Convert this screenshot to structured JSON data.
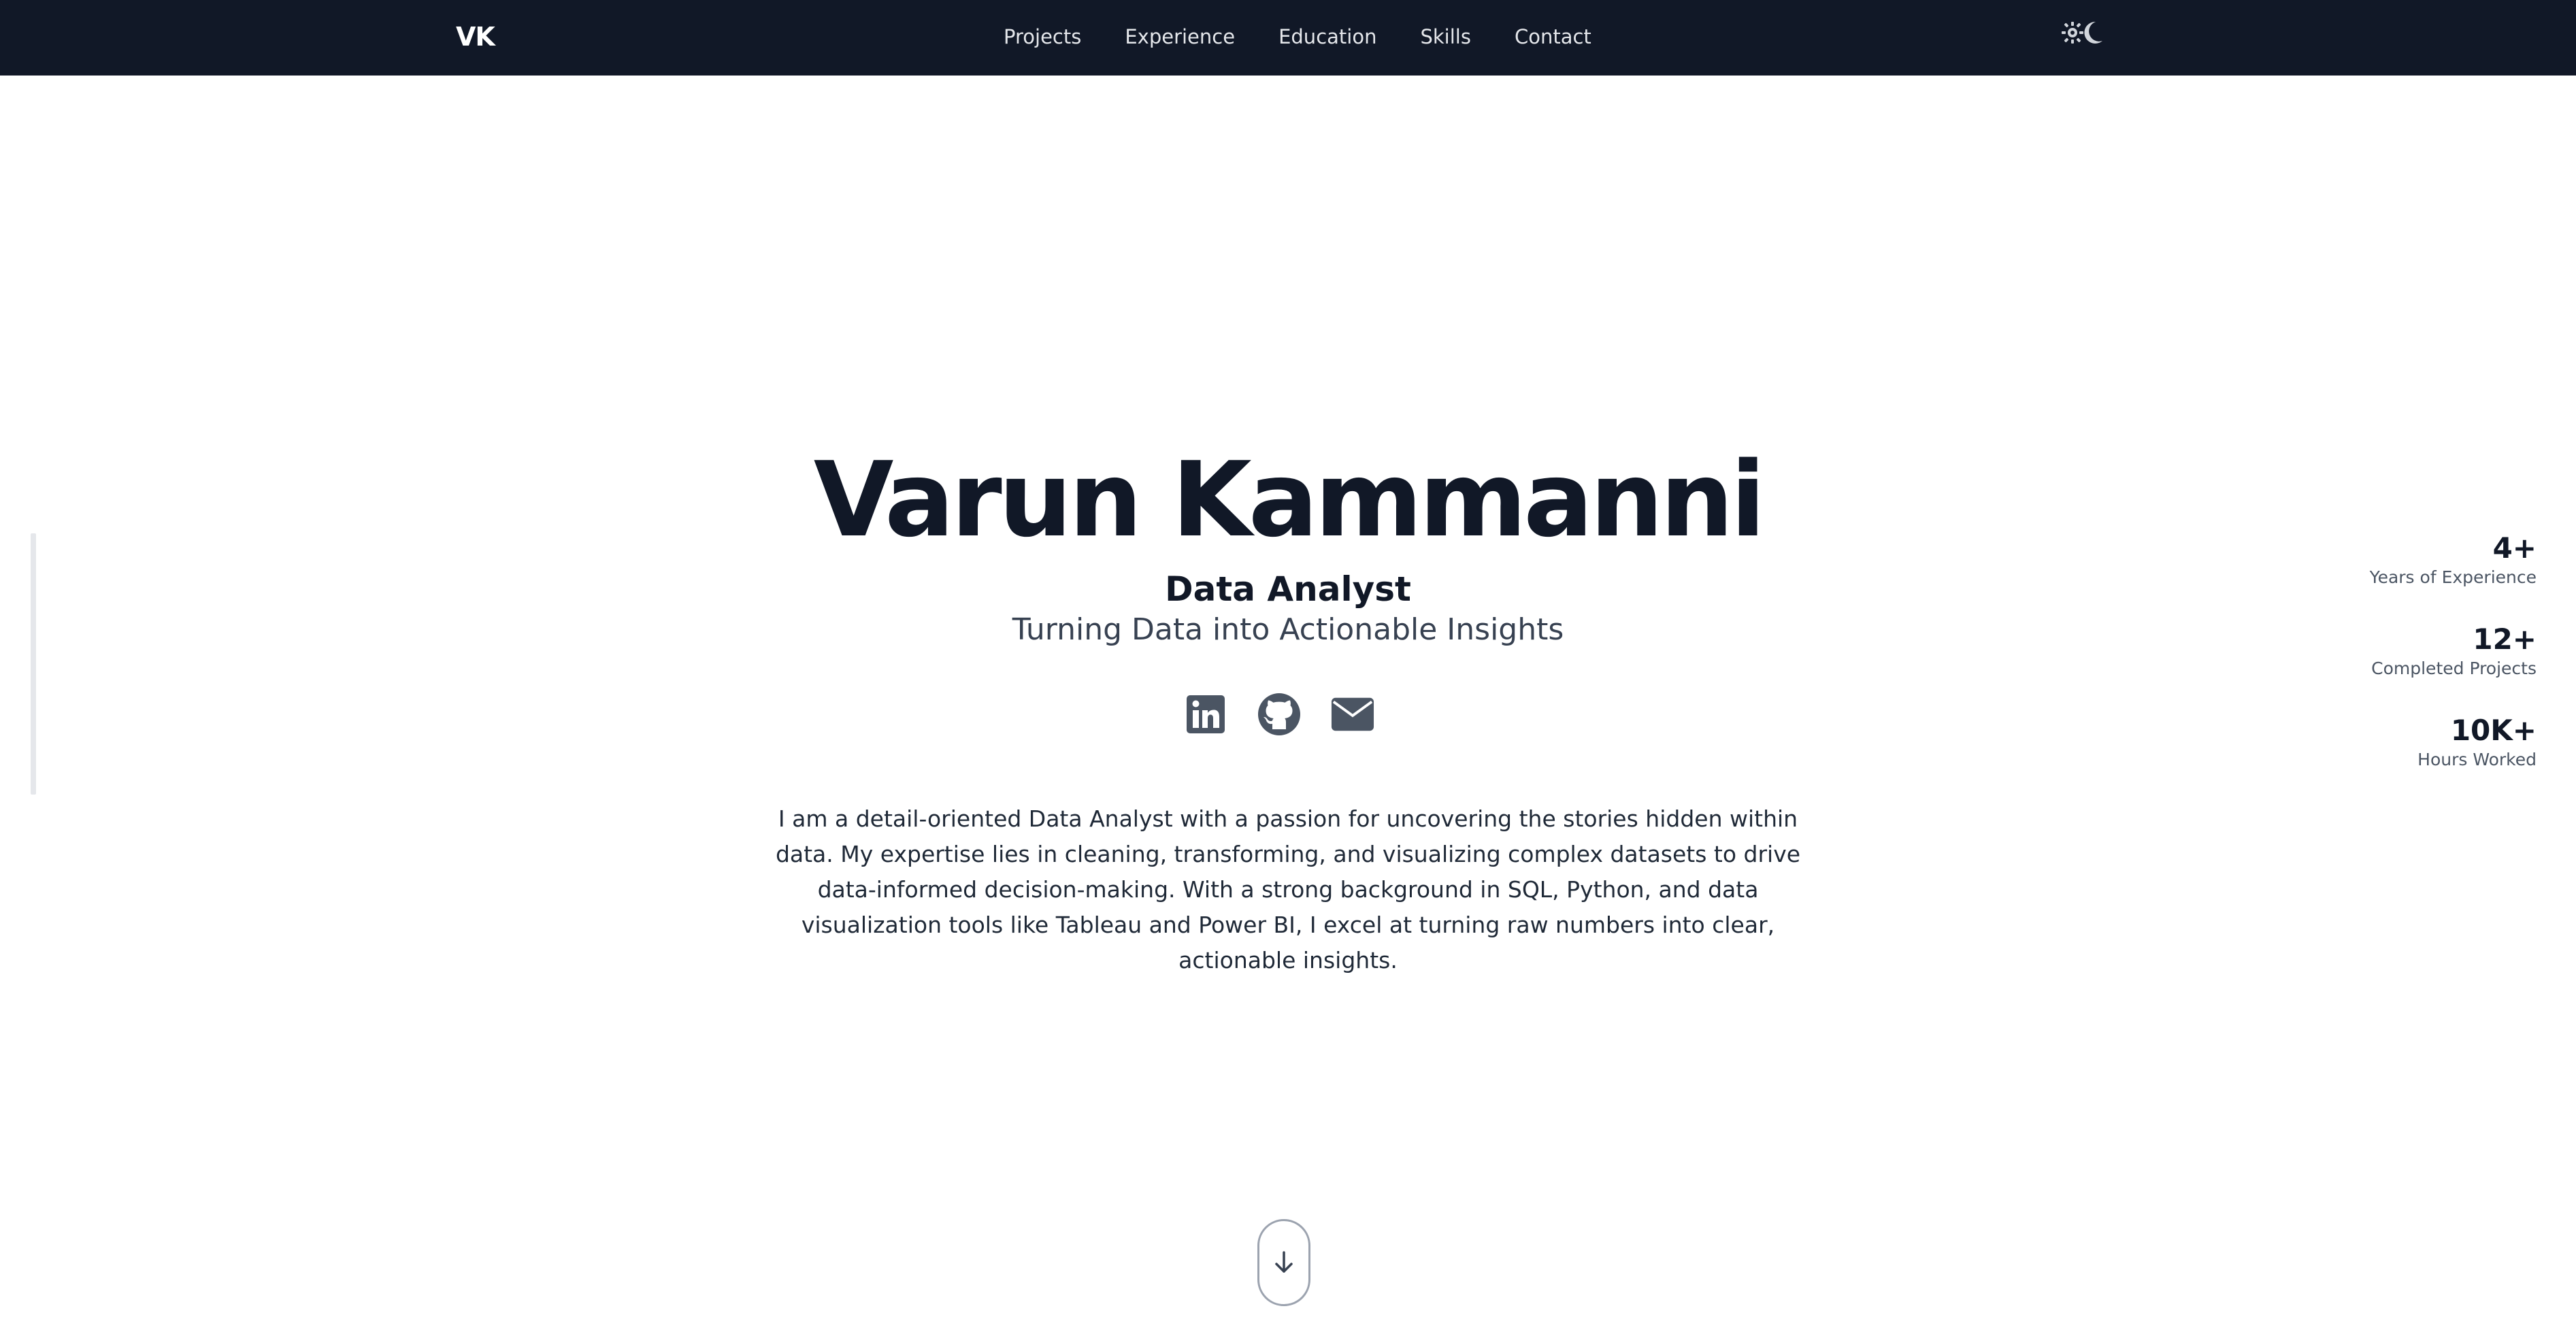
{
  "nav": {
    "logo": "VK",
    "links": [
      "Projects",
      "Experience",
      "Education",
      "Skills",
      "Contact"
    ],
    "theme_toggle_icon": "sun-moon-icon"
  },
  "hero": {
    "name": "Varun Kammanni",
    "role": "Data Analyst",
    "tagline": "Turning Data into Actionable Insights",
    "socials": [
      "linkedin-icon",
      "github-icon",
      "email-icon"
    ],
    "bio": "I am a detail-oriented Data Analyst with a passion for uncovering the stories hidden within data. My expertise lies in cleaning, transforming, and visualizing complex datasets to drive data-informed decision-making. With a strong background in SQL, Python, and data visualization tools like Tableau and Power BI, I excel at turning raw numbers into clear, actionable insights."
  },
  "stats": [
    {
      "value": "4+",
      "label": "Years of Experience"
    },
    {
      "value": "12+",
      "label": "Completed Projects"
    },
    {
      "value": "10K+",
      "label": "Hours Worked"
    }
  ],
  "scroll_icon": "arrow-down-icon",
  "colors": {
    "navbar_bg": "#111827",
    "text_dark": "#111827",
    "icon_gray": "#4b5563"
  }
}
